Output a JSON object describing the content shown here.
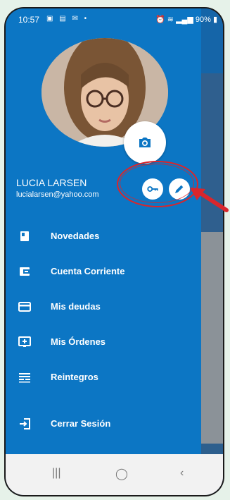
{
  "status_bar": {
    "time": "10:57",
    "battery": "90%"
  },
  "profile": {
    "name": "LUCIA LARSEN",
    "email": "lucialarsen@yahoo.com"
  },
  "menu": {
    "items": [
      {
        "label": "Novedades",
        "icon": "news-icon"
      },
      {
        "label": "Cuenta Corriente",
        "icon": "wallet-icon"
      },
      {
        "label": "Mis deudas",
        "icon": "credit-card-icon"
      },
      {
        "label": "Mis Órdenes",
        "icon": "add-box-icon"
      },
      {
        "label": "Reintegros",
        "icon": "receipt-icon"
      },
      {
        "label": "Cerrar Sesión",
        "icon": "logout-icon"
      }
    ]
  },
  "colors": {
    "drawer": "#0c76c4",
    "highlight": "#d9262c",
    "navbar": "#f2f2f2"
  }
}
